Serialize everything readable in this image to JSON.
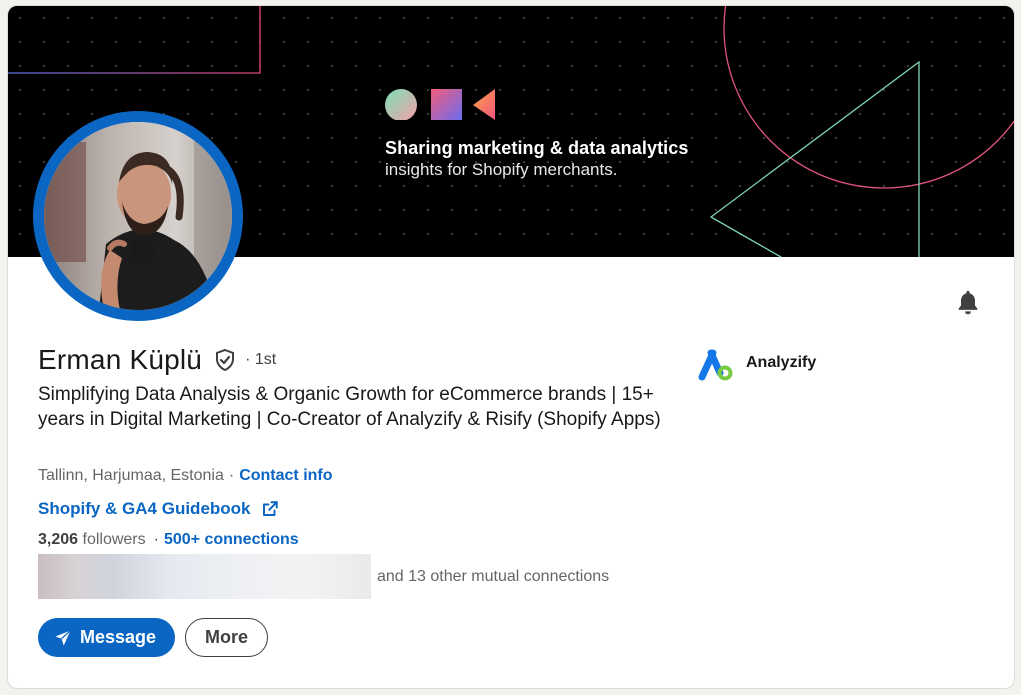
{
  "banner": {
    "line1": "Sharing marketing & data analytics",
    "line2": "insights for Shopify merchants."
  },
  "profile": {
    "name": "Erman Küplü",
    "degree": "· 1st",
    "headline": "Simplifying Data Analysis & Organic Growth for eCommerce brands | 15+ years in Digital Marketing | Co-Creator of Analyzify & Risify (Shopify Apps)",
    "location": "Tallinn, Harjumaa, Estonia",
    "location_sep": "·",
    "contact_info": "Contact info",
    "featured_link": "Shopify & GA4 Guidebook",
    "followers_count": "3,206",
    "followers_label": "followers",
    "follow_sep": "·",
    "connections": "500+ connections",
    "mutual_text": "and 13 other mutual connections"
  },
  "company": {
    "name": "Analyzify"
  },
  "actions": {
    "message": "Message",
    "more": "More"
  },
  "icons": {
    "bell": "bell-icon",
    "verified": "verified-shield-icon",
    "external_link": "external-link-icon",
    "send": "send-icon",
    "company_logo": "analyzify-logo-icon"
  },
  "colors": {
    "accent": "#0a66c2",
    "banner_bg": "#000000",
    "text": "#191919",
    "muted": "#666666"
  }
}
